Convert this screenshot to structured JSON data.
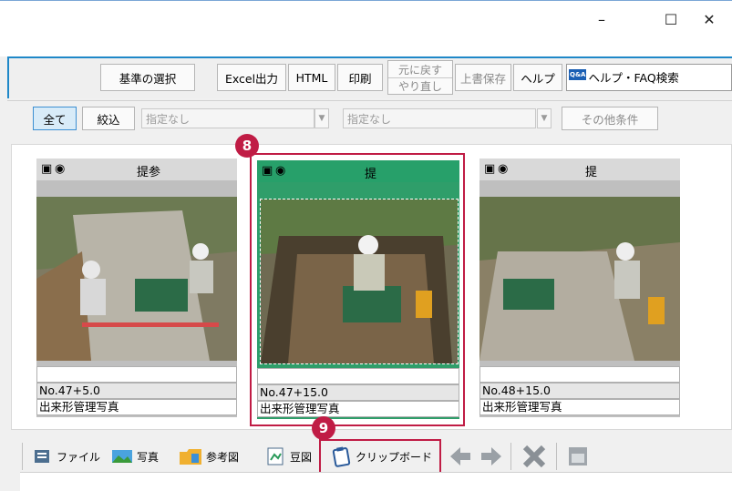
{
  "window": {
    "minimize": "–",
    "maximize": "☐",
    "close": "✕"
  },
  "toolbar": {
    "select_criteria": "基準の選択",
    "excel_output": "Excel出力",
    "html": "HTML",
    "print": "印刷",
    "undo": "元に戻す",
    "redo": "やり直し",
    "overwrite_save": "上書保存",
    "help": "ヘルプ",
    "faq_search": "ヘルプ・FAQ検索",
    "qa_badge": "Q&A"
  },
  "filter": {
    "all": "全て",
    "narrow": "絞込",
    "combo1": "指定なし",
    "combo2": "指定なし",
    "other_conditions": "その他条件"
  },
  "cards": [
    {
      "marks": "提参",
      "station": "No.47+5.0",
      "type": "出来形管理写真",
      "selected": false
    },
    {
      "marks": "提",
      "station": "No.47+15.0",
      "type": "出来形管理写真",
      "selected": true
    },
    {
      "marks": "提",
      "station": "No.48+15.0",
      "type": "出来形管理写真",
      "selected": false
    }
  ],
  "callouts": {
    "eight": "8",
    "nine": "9"
  },
  "bottombar": {
    "file": "ファイル",
    "photo": "写真",
    "reference": "参考図",
    "mame": "豆図",
    "clipboard": "クリップボード"
  },
  "colors": {
    "accent_blue": "#1f88c8",
    "selection_green": "#2f9e6a",
    "callout_red": "#c01c45"
  }
}
